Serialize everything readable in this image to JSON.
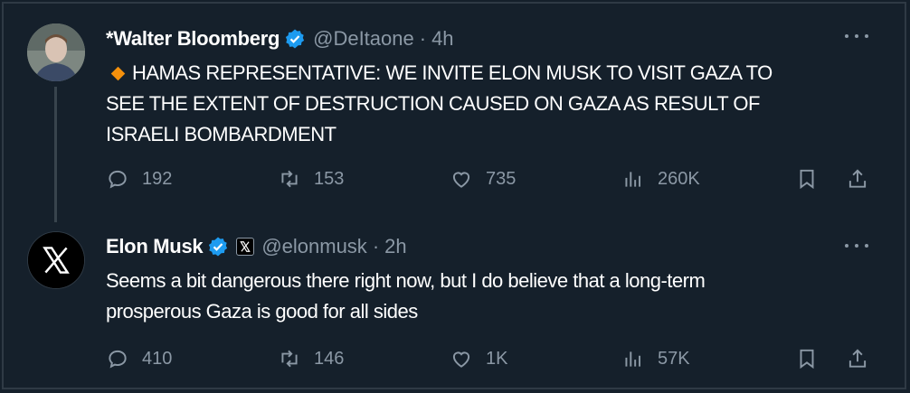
{
  "tweets": [
    {
      "name": "*Walter Bloomberg",
      "handle": "@DeItaone",
      "separator": "·",
      "time": "4h",
      "verified": true,
      "avatar_icon": "profile-photo",
      "text_lines": [
        "HAMAS REPRESENTATIVE: WE INVITE ELON MUSK TO VISIT GAZA TO",
        "SEE THE EXTENT OF DESTRUCTION CAUSED ON GAZA AS RESULT OF",
        "ISRAELI BOMBARDMENT"
      ],
      "lead_icon": "orange-diamond-icon",
      "stats": {
        "replies": "192",
        "retweets": "153",
        "likes": "735",
        "views": "260K"
      }
    },
    {
      "name": "Elon Musk",
      "handle": "@elonmusk",
      "separator": "·",
      "time": "2h",
      "verified": true,
      "affiliation_badge": "x-logo-icon",
      "avatar_icon": "x-logo",
      "text_lines": [
        "Seems a bit dangerous there right now, but I do believe that a long-term",
        "prosperous Gaza is good for all sides"
      ],
      "stats": {
        "replies": "410",
        "retweets": "146",
        "likes": "1K",
        "views": "57K"
      }
    }
  ],
  "colors": {
    "background": "#15202b",
    "text": "#ffffff",
    "muted": "#8b98a5",
    "verified": "#1d9bf0",
    "diamond": "#f4900c"
  }
}
